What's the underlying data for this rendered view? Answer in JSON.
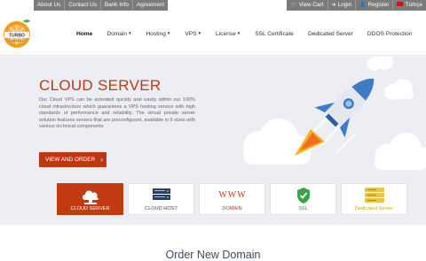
{
  "topbar": {
    "left_links": [
      "About Us",
      "Contact Us",
      "Bank Info",
      "Agreement"
    ],
    "view_cart": "View Cart",
    "login": "Login",
    "register": "Register",
    "language": "Türkçe"
  },
  "logo": {
    "brand": "TURBO",
    "tagline": "Digital Solutions"
  },
  "nav": {
    "items": [
      {
        "label": "Home",
        "has_dropdown": false,
        "active": true
      },
      {
        "label": "Domain",
        "has_dropdown": true
      },
      {
        "label": "Hosting",
        "has_dropdown": true
      },
      {
        "label": "VPS",
        "has_dropdown": true
      },
      {
        "label": "License",
        "has_dropdown": true
      },
      {
        "label": "SSL Certificate",
        "has_dropdown": false
      },
      {
        "label": "Dedicated Server",
        "has_dropdown": false
      },
      {
        "label": "DDOS Protection",
        "has_dropdown": false
      }
    ]
  },
  "hero": {
    "title": "CLOUD SERVER",
    "text": "Our Cloud VPS can be activated quickly and easily within our 100% cloud infrastructure which guarantees a VPS hosting service with high standards of performance and reliability. The virtual private server solution features servers that are preconfigured, available in 5 sizes with various technical components",
    "button": "VIEW AND ORDER",
    "button_arrow": "›"
  },
  "tiles": [
    {
      "label": "CLOUD SERVER",
      "icon": "cloud-server-icon",
      "active": true
    },
    {
      "label": "CLOUD HOST",
      "icon": "server-rack-icon"
    },
    {
      "label": "DOMAIN",
      "icon": "www-icon",
      "glyph": "WWW"
    },
    {
      "label": "SSL",
      "icon": "shield-check-icon"
    },
    {
      "label": "Dedicated Server",
      "icon": "database-icon"
    }
  ],
  "order": {
    "title": "Order New Domain"
  },
  "colors": {
    "accent": "#bd3716",
    "topbar": "#7b7b7b",
    "hero_bg": "#eceef3",
    "ssl_green": "#3a8a3a",
    "dedicated_yellow": "#e8c54a"
  }
}
